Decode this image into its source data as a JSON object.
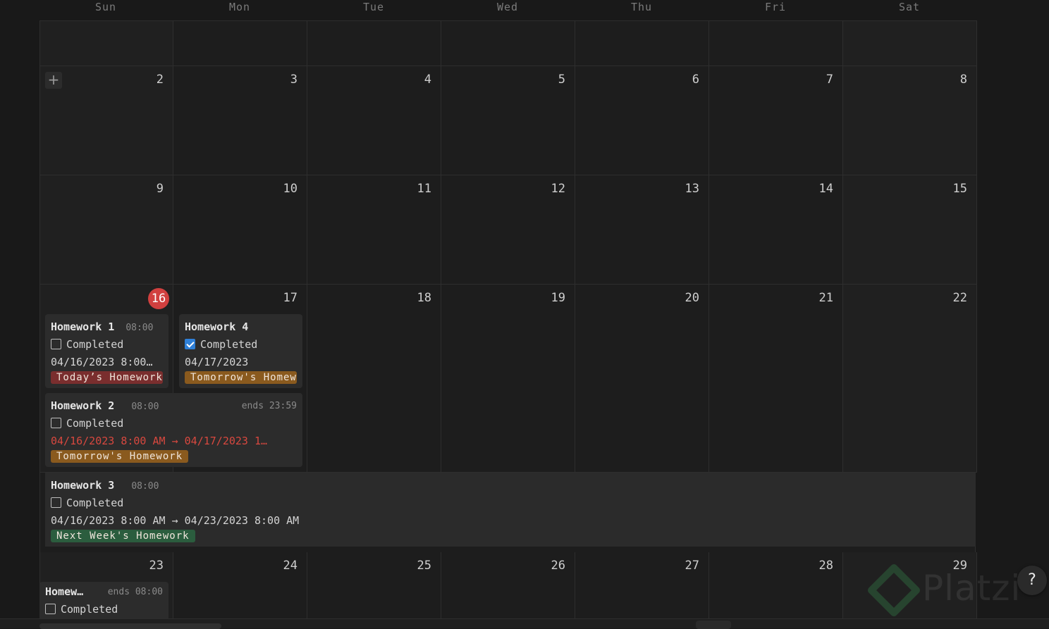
{
  "weekdays": [
    "Sun",
    "Mon",
    "Tue",
    "Wed",
    "Thu",
    "Fri",
    "Sat"
  ],
  "weeks": [
    {
      "days": [
        "",
        "",
        "",
        "",
        "",
        "",
        ""
      ]
    },
    {
      "days": [
        "2",
        "3",
        "4",
        "5",
        "6",
        "7",
        "8"
      ]
    },
    {
      "days": [
        "9",
        "10",
        "11",
        "12",
        "13",
        "14",
        "15"
      ]
    },
    {
      "days": [
        "16",
        "17",
        "18",
        "19",
        "20",
        "21",
        "22"
      ]
    },
    {
      "days": [
        "23",
        "24",
        "25",
        "26",
        "27",
        "28",
        "29"
      ]
    }
  ],
  "today": "16",
  "add_button": "+",
  "events": {
    "hw1": {
      "title": "Homework 1",
      "time": "08:00",
      "checkbox_label": "Completed",
      "checked": false,
      "date": "04/16/2023 8:00…",
      "tag": "Today’s Homework",
      "tag_color": "#7a2e2e"
    },
    "hw4": {
      "title": "Homework 4",
      "time": "",
      "checkbox_label": "Completed",
      "checked": true,
      "date": "04/17/2023",
      "tag": "Tomorrow's Homework",
      "tag_color": "#8a5a1e"
    },
    "hw2": {
      "title": "Homework 2",
      "time": "08:00",
      "ends": "ends 23:59",
      "checkbox_label": "Completed",
      "checked": false,
      "date": "04/16/2023 8:00 AM → 04/17/2023 1…",
      "tag": "Tomorrow's Homework",
      "tag_color": "#8a5a1e"
    },
    "hw3": {
      "title": "Homework 3",
      "time": "08:00",
      "checkbox_label": "Completed",
      "checked": false,
      "date": "04/16/2023 8:00 AM → 04/23/2023 8:00 AM",
      "tag": "Next Week's Homework",
      "tag_color": "#2b5d3e"
    },
    "hw_next": {
      "title": "Homew…",
      "ends": "ends 08:00",
      "checkbox_label": "Completed",
      "checked": false
    }
  },
  "help_label": "?",
  "watermark": "Platzi",
  "colors": {
    "background": "#191919",
    "today": "#d1403f",
    "checkbox_checked": "#2f80d8",
    "overdue_date": "#d8483f"
  }
}
